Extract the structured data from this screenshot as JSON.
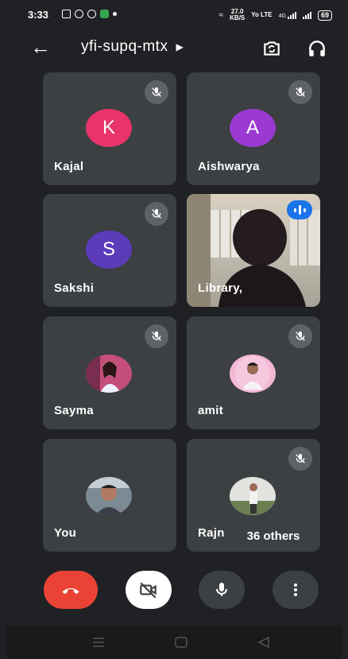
{
  "status_bar": {
    "time": "3:33",
    "speed_value": "27.0",
    "speed_unit": "KB/S",
    "network_1": "Yo LTE",
    "network_2": "4G",
    "battery": "69"
  },
  "header": {
    "meeting_code": "yfi-supq-mtx",
    "back_icon": "arrow-left-icon",
    "camera_switch_icon": "camera-switch-icon",
    "audio_icon": "headphones-icon"
  },
  "participants": [
    {
      "name": "Kajal",
      "initial": "K",
      "avatar_color": "#e8336b",
      "muted": true
    },
    {
      "name": "Aishwarya",
      "initial": "A",
      "avatar_color": "#9b3ad3",
      "muted": true
    },
    {
      "name": "Sakshi",
      "initial": "S",
      "avatar_color": "#5b3bb8",
      "muted": true
    },
    {
      "name": "Library,",
      "video_on": true,
      "speaking": true
    },
    {
      "name": "Sayma",
      "photo": true,
      "muted": true
    },
    {
      "name": "amit",
      "photo": true,
      "muted": true
    },
    {
      "name": "You",
      "photo": true,
      "muted": false
    },
    {
      "name": "Rajn",
      "photo": true,
      "muted": true
    }
  ],
  "others_chip": "36 others",
  "controls": {
    "end_call": "end-call-icon",
    "camera_off": "camera-off-icon",
    "mic": "mic-icon",
    "more": "more-vert-icon"
  },
  "colors": {
    "end_call": "#ea4335",
    "speaking": "#1a73e8",
    "tile": "#3c4043",
    "background": "#202124"
  }
}
